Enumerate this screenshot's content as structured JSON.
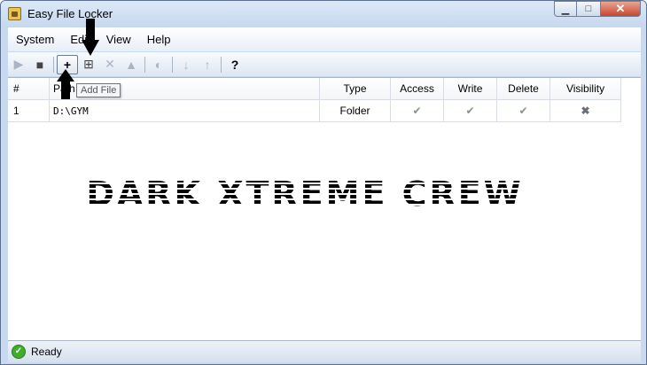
{
  "window": {
    "title": "Easy File Locker"
  },
  "menu": [
    "System",
    "Edit",
    "View",
    "Help"
  ],
  "toolbar": {
    "tooltip": "Add File",
    "help_label": "?"
  },
  "table": {
    "headers": {
      "num": "#",
      "path": "Path",
      "type": "Type",
      "access": "Access",
      "write": "Write",
      "delete": "Delete",
      "visibility": "Visibility"
    },
    "rows": [
      {
        "num": "1",
        "path": "D:\\GYM",
        "type": "Folder",
        "access": "✔",
        "write": "✔",
        "delete": "✔",
        "visibility": "✖"
      }
    ]
  },
  "watermark": "DARK XTREME CREW",
  "status": {
    "text": "Ready"
  }
}
